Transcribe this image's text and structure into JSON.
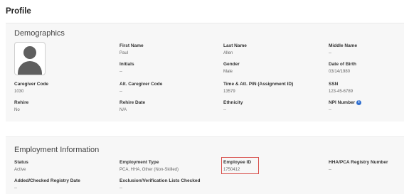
{
  "page_title": "Profile",
  "demographics": {
    "title": "Demographics",
    "fields": {
      "first_name": {
        "label": "First Name",
        "value": "Paul"
      },
      "last_name": {
        "label": "Last Name",
        "value": "Allen"
      },
      "middle_name": {
        "label": "Middle Name",
        "value": "--"
      },
      "initials": {
        "label": "Initials",
        "value": "--"
      },
      "gender": {
        "label": "Gender",
        "value": "Male"
      },
      "date_of_birth": {
        "label": "Date of Birth",
        "value": "03/14/1980"
      },
      "caregiver_code": {
        "label": "Caregiver Code",
        "value": "1030"
      },
      "alt_caregiver_code": {
        "label": "Alt. Caregiver Code",
        "value": "--"
      },
      "time_att_pin": {
        "label": "Time & Att. PIN (Assignment ID)",
        "value": "13579"
      },
      "ssn": {
        "label": "SSN",
        "value": "123-45-6789"
      },
      "rehire": {
        "label": "Rehire",
        "value": "No"
      },
      "rehire_date": {
        "label": "Rehire Date",
        "value": "N/A"
      },
      "ethnicity": {
        "label": "Ethnicity",
        "value": "--"
      },
      "npi_number": {
        "label": "NPI Number",
        "value": "--",
        "icon": "info-icon"
      }
    }
  },
  "employment": {
    "title": "Employment Information",
    "fields": {
      "status": {
        "label": "Status",
        "value": "Active"
      },
      "employment_type": {
        "label": "Employment Type",
        "value": "PCA, HHA, Other (Non-Skilled)"
      },
      "employee_id": {
        "label": "Employee ID",
        "value": "1750412",
        "highlight_color": "#d9534f"
      },
      "registry_number": {
        "label": "HHA/PCA Registry Number",
        "value": "--"
      },
      "added_checked_registry_date": {
        "label": "Added/Checked Registry Date",
        "value": "--"
      },
      "exclusion_lists_checked": {
        "label": "Exclusion/Verification Lists Checked",
        "value": "--"
      }
    }
  },
  "colors": {
    "accent": "#2f6fd0",
    "highlight": "#d9534f",
    "panel": "#f7f7f7"
  }
}
